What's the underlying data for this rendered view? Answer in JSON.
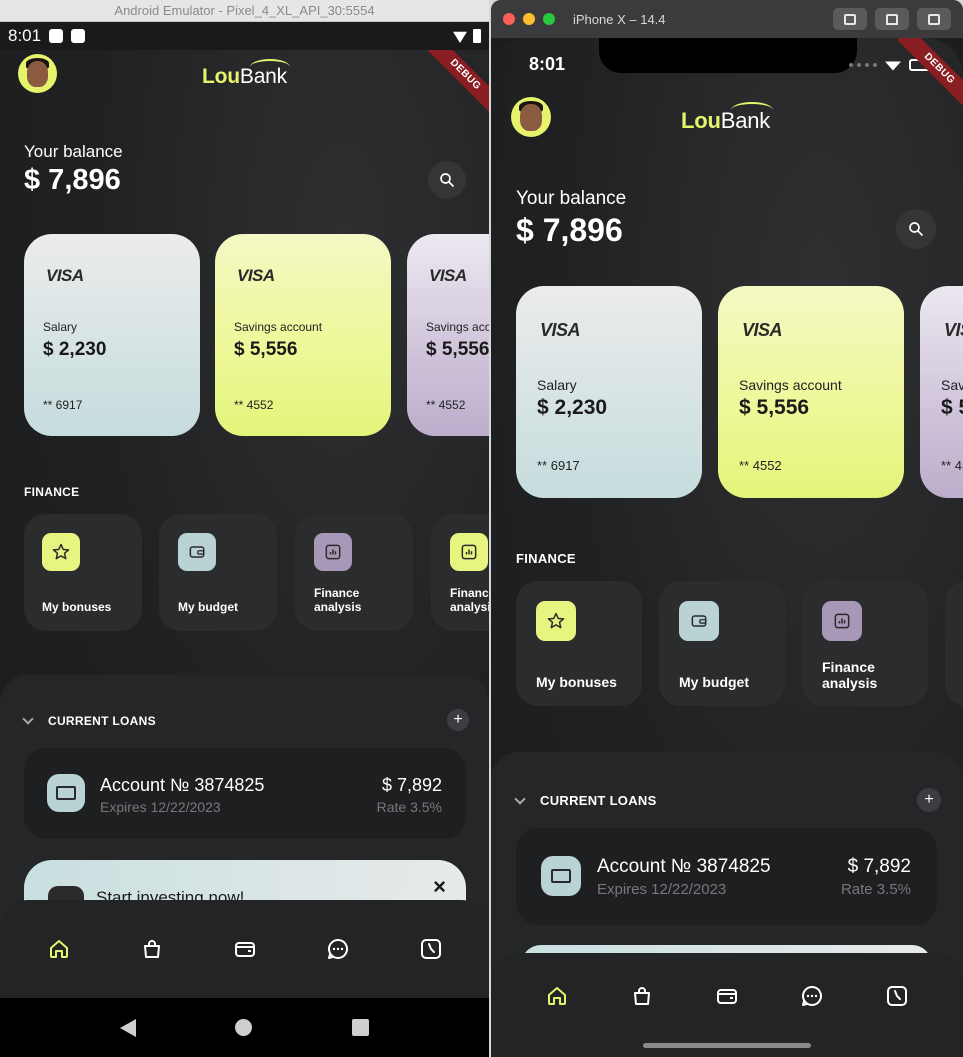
{
  "android": {
    "window_title": "Android Emulator - Pixel_4_XL_API_30:5554",
    "status_time": "8:01",
    "debug_label": "DEBUG"
  },
  "ios": {
    "window_title": "iPhone X – 14.4",
    "status_time": "8:01",
    "debug_label": "DEBUG"
  },
  "app": {
    "logo_lou": "Lou",
    "logo_bank": "Bank",
    "balance_label": "Your balance",
    "balance_value": "$ 7,896",
    "cards": [
      {
        "brand": "VISA",
        "type": "Salary",
        "amount": "$ 2,230",
        "number": "** 6917"
      },
      {
        "brand": "VISA",
        "type": "Savings account",
        "amount": "$ 5,556",
        "number": "** 4552"
      },
      {
        "brand": "VISA",
        "type": "Savings account",
        "amount": "$ 5,556",
        "number": "** 4552"
      }
    ],
    "finance_section": "FINANCE",
    "tiles": [
      {
        "label": "My bonuses",
        "icon": "star-icon"
      },
      {
        "label": "My budget",
        "icon": "wallet-icon"
      },
      {
        "label": "Finance analysis",
        "label_line1": "Finance",
        "label_line2": "analysis",
        "icon": "chart-icon"
      },
      {
        "label": "Finance analysis",
        "label_line1": "Finance",
        "label_line2": "analysis",
        "icon": "chart-icon"
      }
    ],
    "loans_section": "CURRENT LOANS",
    "loan": {
      "title": "Account № 3874825",
      "expires": "Expires 12/22/2023",
      "amount": "$ 7,892",
      "rate": "Rate 3.5%"
    },
    "invest_banner": {
      "title": "Start investing now!",
      "close": "×"
    },
    "tabs": [
      "home-icon",
      "shopping-bag-icon",
      "wallet-icon",
      "chat-icon",
      "history-icon"
    ]
  }
}
